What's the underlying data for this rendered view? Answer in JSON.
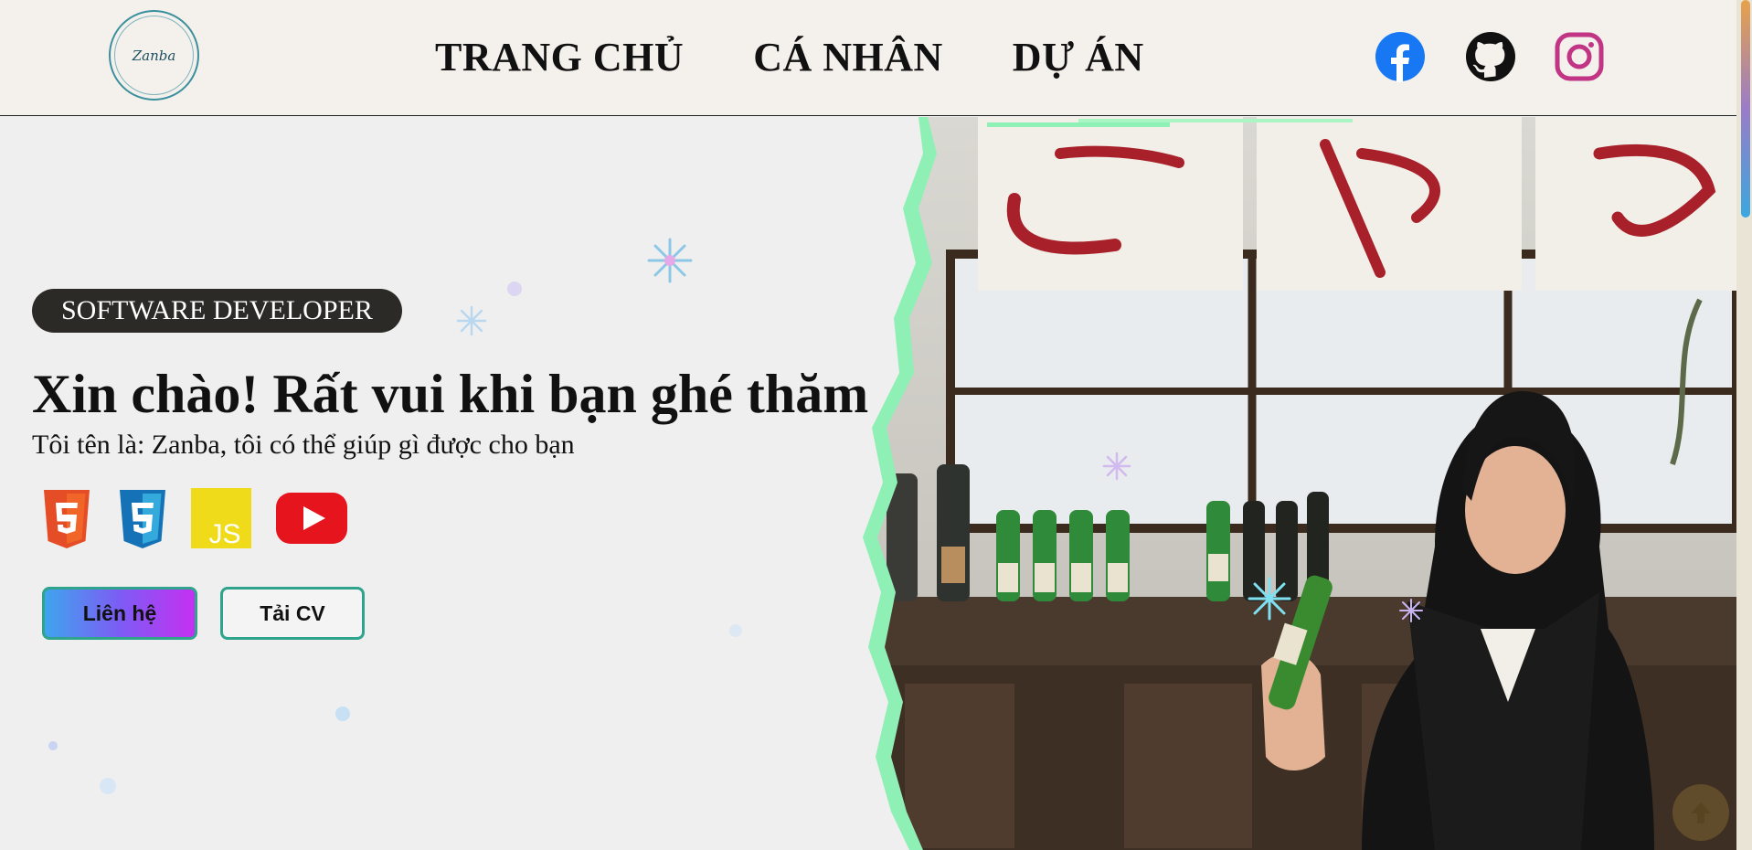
{
  "header": {
    "logo_text": "Zanba",
    "nav": [
      "TRANG CHỦ",
      "CÁ NHÂN",
      "DỰ ÁN"
    ],
    "social_icons": [
      "facebook-icon",
      "github-icon",
      "instagram-icon"
    ]
  },
  "hero": {
    "role_badge": "SOFTWARE DEVELOPER",
    "title": "Xin chào! Rất vui khi bạn ghé thăm",
    "subtitle": "Tôi tên là: Zanba, tôi có thể giúp gì được cho bạn",
    "tech_icons": [
      "html5-icon",
      "css3-icon",
      "javascript-icon",
      "youtube-icon"
    ],
    "buttons": {
      "contact": "Liên hệ",
      "download_cv": "Tải CV"
    }
  },
  "colors": {
    "header_bg": "#f4f1ec",
    "badge_bg": "#2b2a26",
    "button_border": "#2fa38c",
    "photo_border": "#8ff0b5",
    "facebook": "#1877f2",
    "instagram": "#c13584"
  }
}
